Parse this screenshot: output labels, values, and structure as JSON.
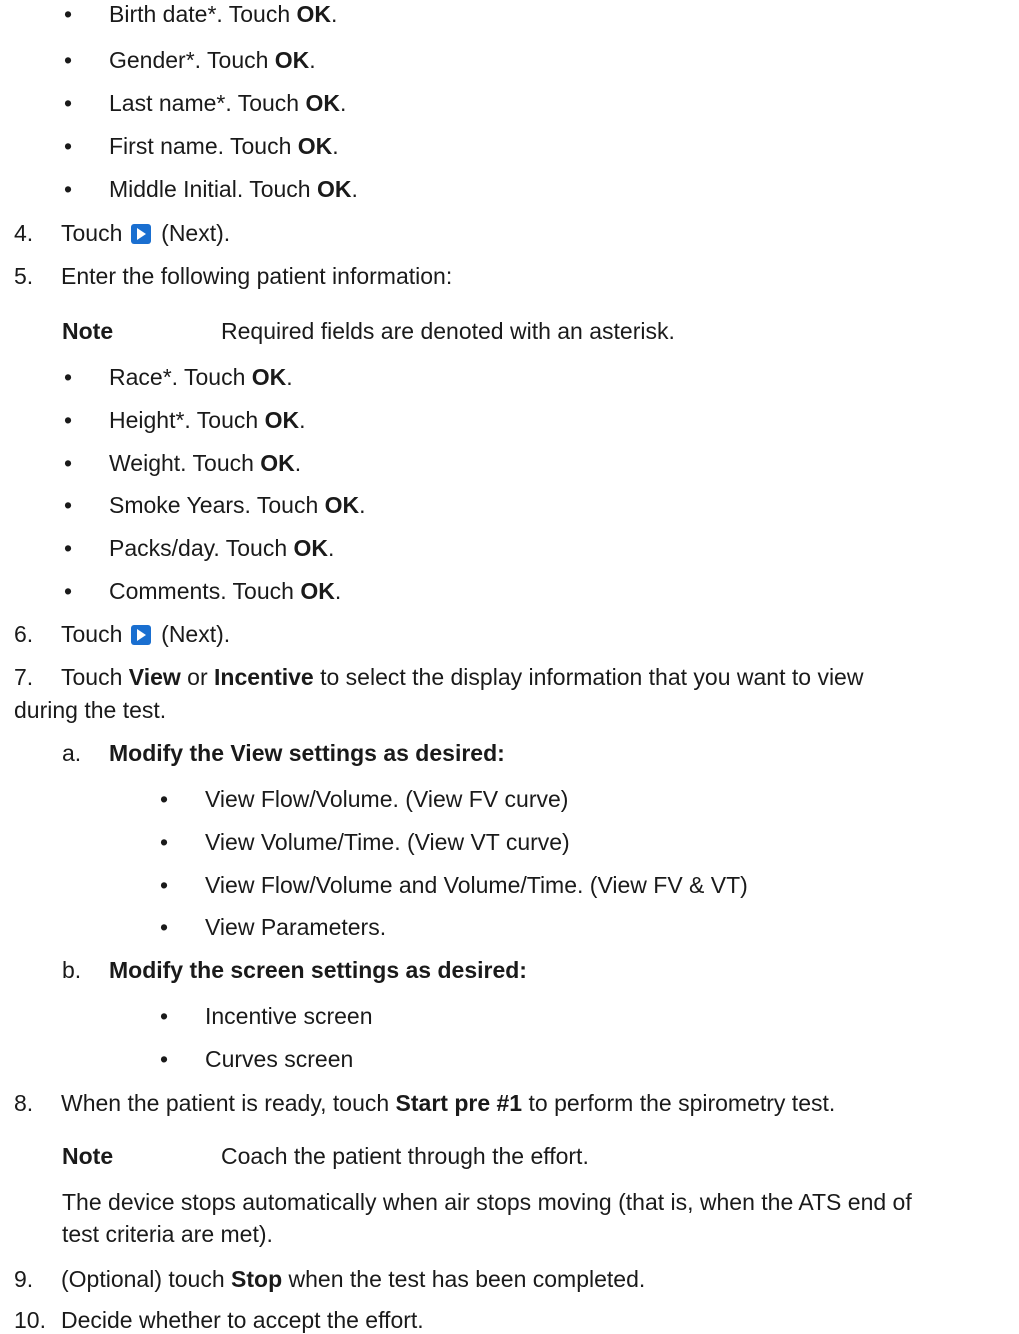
{
  "bullets_group1": [
    {
      "text": "Birth date*. Touch ",
      "bold": "OK",
      "end": "."
    },
    {
      "text": "Gender*. Touch ",
      "bold": "OK",
      "end": "."
    },
    {
      "text": "Last name*. Touch ",
      "bold": "OK",
      "end": "."
    },
    {
      "text": "First name. Touch ",
      "bold": "OK",
      "end": "."
    },
    {
      "text": "Middle Initial. Touch ",
      "bold": "OK",
      "end": "."
    }
  ],
  "step4": {
    "num": "4.",
    "pre": "Touch",
    "post": "(Next).",
    "icon": "next-icon"
  },
  "step5": {
    "num": "5.",
    "text": "Enter the following patient information:"
  },
  "note1": {
    "label": "Note",
    "text": "Required fields are denoted with an asterisk."
  },
  "bullets_group2": [
    {
      "text": "Race*. Touch ",
      "bold": "OK",
      "end": "."
    },
    {
      "text": "Height*. Touch ",
      "bold": "OK",
      "end": "."
    },
    {
      "text": "Weight. Touch ",
      "bold": "OK",
      "end": "."
    },
    {
      "text": "Smoke Years. Touch ",
      "bold": "OK",
      "end": "."
    },
    {
      "text": "Packs/day. Touch ",
      "bold": "OK",
      "end": "."
    },
    {
      "text": "Comments. Touch ",
      "bold": "OK",
      "end": "."
    }
  ],
  "step6": {
    "num": "6.",
    "pre": "Touch",
    "post": "(Next).",
    "icon": "next-icon"
  },
  "step7": {
    "num": "7.",
    "t1": "Touch ",
    "b1": "View",
    "t2": " or ",
    "b2": "Incentive",
    "t3": " to select the display information that you want to view",
    "line2": "during the test."
  },
  "step7a": {
    "letter": "a.",
    "title": "Modify the View settings as desired:"
  },
  "view_items": [
    "View Flow/Volume. (View FV curve)",
    "View Volume/Time. (View VT curve)",
    "View Flow/Volume and Volume/Time. (View FV & VT)",
    "View Parameters."
  ],
  "step7b": {
    "letter": "b.",
    "title": "Modify the screen settings as desired:"
  },
  "screen_items": [
    "Incentive screen",
    "Curves screen"
  ],
  "step8": {
    "num": "8.",
    "t1": "When the patient is ready, touch ",
    "b1": "Start pre #1",
    "t2": " to perform the spirometry test."
  },
  "note2": {
    "label": "Note",
    "text": "Coach the patient through the effort."
  },
  "para": {
    "line1": "The device stops automatically when air stops moving (that is, when the ATS end of",
    "line2": "test criteria are met)."
  },
  "step9": {
    "num": "9.",
    "t1": "(Optional) touch ",
    "b1": "Stop",
    "t2": " when the test has been completed."
  },
  "step10": {
    "num": "10.",
    "text": "Decide whether to accept the effort."
  },
  "bullet_glyph": "•"
}
